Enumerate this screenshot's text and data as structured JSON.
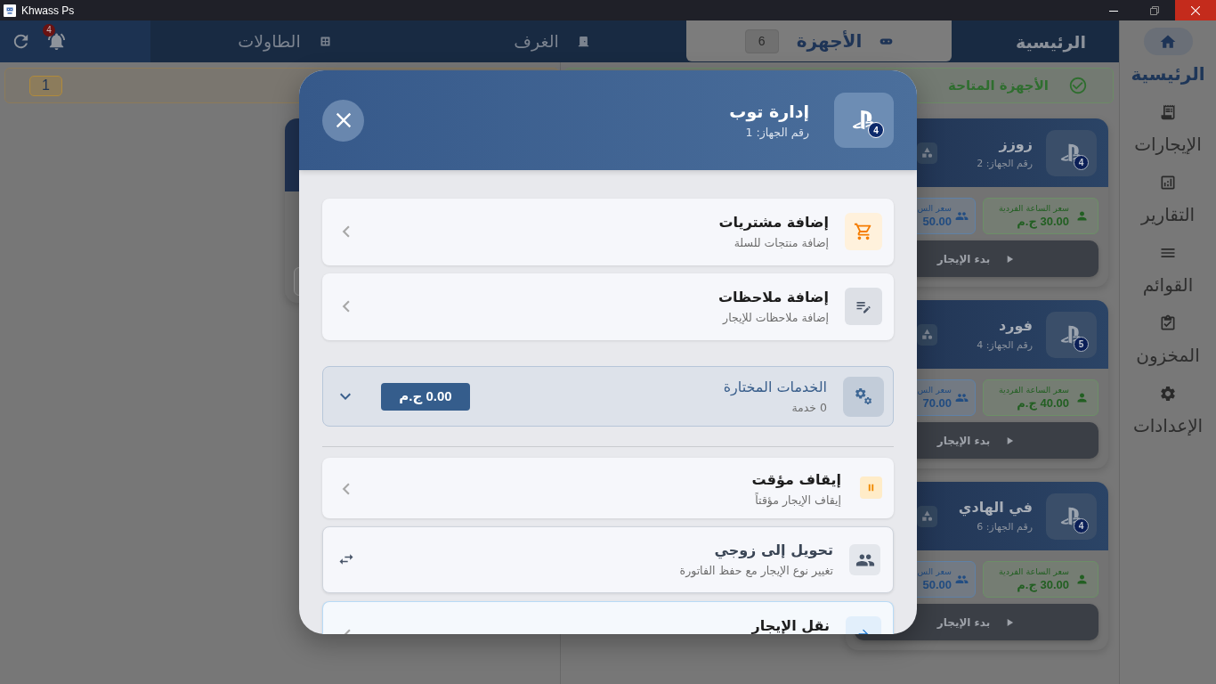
{
  "window": {
    "title": "Khwass Ps"
  },
  "top_bar": {
    "title": "الرئيسية",
    "tabs": [
      {
        "label": "الأجهزة",
        "count": "6",
        "selected": true
      },
      {
        "label": "الغرف",
        "selected": false
      },
      {
        "label": "الطاولات",
        "selected": false
      }
    ],
    "notifications": {
      "count": "4"
    }
  },
  "sidebar": {
    "items": [
      {
        "label": "الرئيسية",
        "selected": true
      },
      {
        "label": "الإيجارات",
        "selected": false
      },
      {
        "label": "التقارير",
        "selected": false
      },
      {
        "label": "القوائم",
        "selected": false
      },
      {
        "label": "المخزون",
        "selected": false
      },
      {
        "label": "الإعدادات",
        "selected": false
      }
    ]
  },
  "right_panel": {
    "header": {
      "title": "الأجهزة المتاحة"
    },
    "devices": [
      {
        "name": "زوزز",
        "number": "رقم الجهاز: 2",
        "controllers": "4",
        "single_rate": {
          "label": "سعر الساعة الفردية",
          "price": "30.00 ج.م"
        },
        "group_rate": {
          "label": "سعر الس",
          "price": "50.00"
        },
        "action": "بدء الإيجار"
      },
      {
        "name": "فورد",
        "number": "رقم الجهاز: 4",
        "controllers": "5",
        "single_rate": {
          "label": "سعر الساعة الفردية",
          "price": "40.00 ج.م"
        },
        "group_rate": {
          "label": "سعر الس",
          "price": "70.00"
        },
        "action": "بدء الإيجار"
      },
      {
        "name": "في الهادي",
        "number": "رقم الجهاز: 6",
        "controllers": "4",
        "single_rate": {
          "label": "سعر الساعة الفردية",
          "price": "30.00 ج.م"
        },
        "group_rate": {
          "label": "سعر الس",
          "price": "50.00"
        },
        "action": "بدء الإيجار"
      }
    ]
  },
  "left_panel": {
    "header": {
      "count": "1"
    }
  },
  "modal": {
    "title": "إدارة توب",
    "subtitle": "رقم الجهاز: 1",
    "controllers": "4",
    "actions": [
      {
        "title": "إضافة مشتريات",
        "subtitle": "إضافة منتجات للسلة"
      },
      {
        "title": "إضافة ملاحظات",
        "subtitle": "إضافة ملاحظات للإيجار"
      }
    ],
    "services": {
      "title": "الخدمات المختارة",
      "count": "0 خدمة",
      "total": "0.00 ج.م",
      "expanded": false
    },
    "rental_actions": [
      {
        "kind": "action",
        "title": "إيقاف مؤقت",
        "subtitle": "إيقاف الإيجار مؤقتاً"
      },
      {
        "kind": "convert",
        "title": "تحويل إلى زوجي",
        "subtitle": "تغيير نوع الإيجار مع حفظ الفاتورة"
      },
      {
        "kind": "action",
        "title": "نقل الإيجار"
      }
    ]
  }
}
